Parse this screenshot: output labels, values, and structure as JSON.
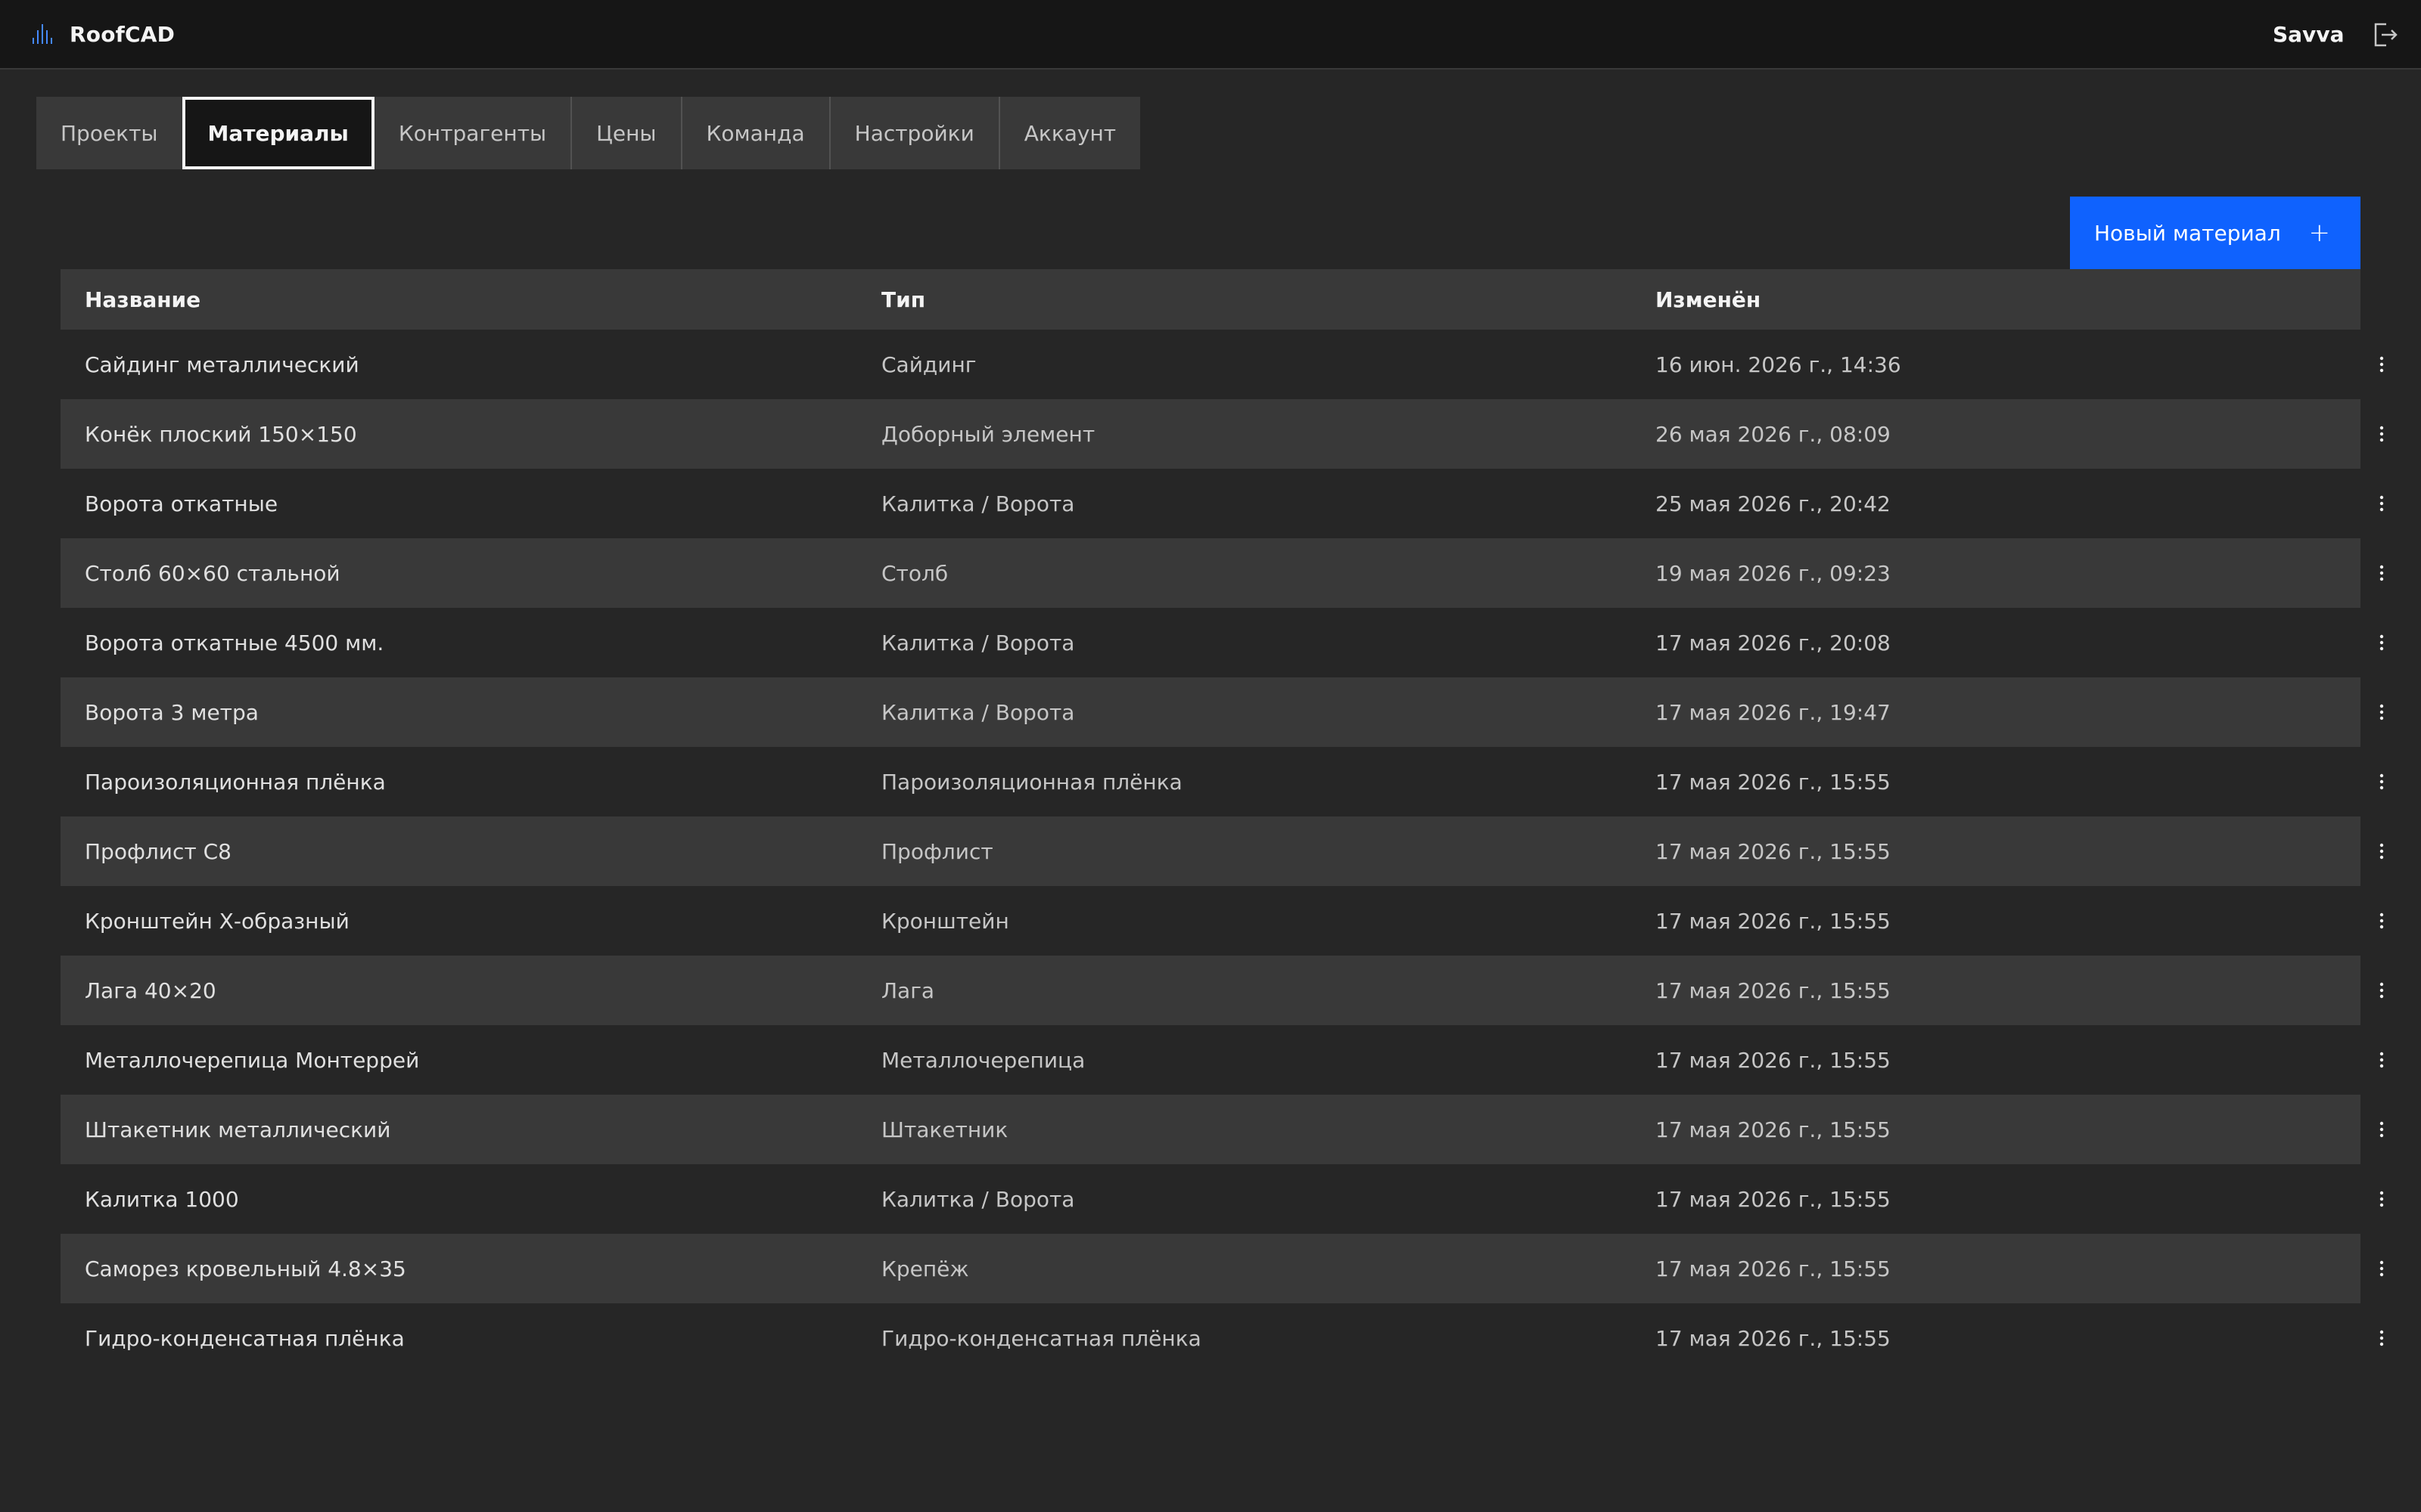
{
  "header": {
    "app_name": "RoofCAD",
    "user": "Savva",
    "logo_icon": "roof-logo-icon",
    "logout_icon": "logout-icon"
  },
  "tabs": [
    {
      "label": "Проекты",
      "active": false
    },
    {
      "label": "Материалы",
      "active": true
    },
    {
      "label": "Контрагенты",
      "active": false
    },
    {
      "label": "Цены",
      "active": false
    },
    {
      "label": "Команда",
      "active": false
    },
    {
      "label": "Настройки",
      "active": false
    },
    {
      "label": "Аккаунт",
      "active": false
    }
  ],
  "toolbar": {
    "new_button_label": "Новый материал",
    "new_button_icon": "+"
  },
  "colors": {
    "accent": "#0f62fe",
    "background": "#262626",
    "header_bg": "#161616",
    "row_alt": "#393939"
  },
  "table": {
    "columns": [
      "Название",
      "Тип",
      "Изменён"
    ],
    "rows": [
      {
        "name": "Сайдинг металлический",
        "type": "Сайдинг",
        "modified": "16 июн. 2026 г., 14:36"
      },
      {
        "name": "Конёк плоский 150×150",
        "type": "Доборный элемент",
        "modified": "26 мая 2026 г., 08:09"
      },
      {
        "name": "Ворота откатные",
        "type": "Калитка / Ворота",
        "modified": "25 мая 2026 г., 20:42"
      },
      {
        "name": "Столб 60×60 стальной",
        "type": "Столб",
        "modified": "19 мая 2026 г., 09:23"
      },
      {
        "name": "Ворота откатные 4500 мм.",
        "type": "Калитка / Ворота",
        "modified": "17 мая 2026 г., 20:08"
      },
      {
        "name": "Ворота 3 метра",
        "type": "Калитка / Ворота",
        "modified": "17 мая 2026 г., 19:47"
      },
      {
        "name": "Пароизоляционная плёнка",
        "type": "Пароизоляционная плёнка",
        "modified": "17 мая 2026 г., 15:55"
      },
      {
        "name": "Профлист С8",
        "type": "Профлист",
        "modified": "17 мая 2026 г., 15:55"
      },
      {
        "name": "Кронштейн Х-образный",
        "type": "Кронштейн",
        "modified": "17 мая 2026 г., 15:55"
      },
      {
        "name": "Лага 40×20",
        "type": "Лага",
        "modified": "17 мая 2026 г., 15:55"
      },
      {
        "name": "Металлочерепица Монтеррей",
        "type": "Металлочерепица",
        "modified": "17 мая 2026 г., 15:55"
      },
      {
        "name": "Штакетник металлический",
        "type": "Штакетник",
        "modified": "17 мая 2026 г., 15:55"
      },
      {
        "name": "Калитка 1000",
        "type": "Калитка / Ворота",
        "modified": "17 мая 2026 г., 15:55"
      },
      {
        "name": "Саморез кровельный 4.8×35",
        "type": "Крепёж",
        "modified": "17 мая 2026 г., 15:55"
      },
      {
        "name": "Гидро-конденсатная плёнка",
        "type": "Гидро-конденсатная плёнка",
        "modified": "17 мая 2026 г., 15:55"
      }
    ]
  }
}
